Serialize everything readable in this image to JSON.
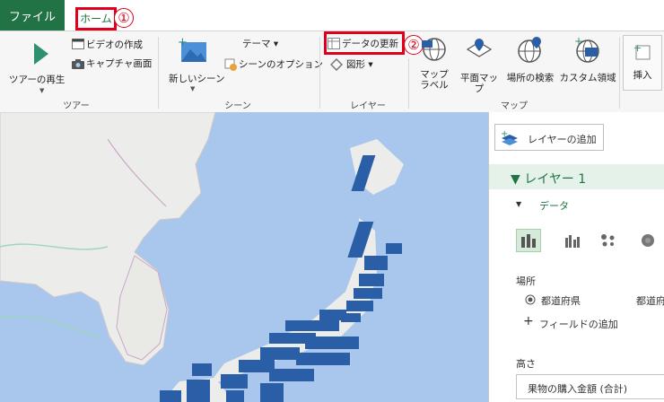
{
  "tabs": {
    "file": "ファイル",
    "home": "ホーム"
  },
  "callouts": {
    "one": "①",
    "two": "②"
  },
  "ribbon": {
    "tour": {
      "play_label": "ツアーの再生",
      "video_label": "ビデオの作成",
      "capture_label": "キャプチャ画面",
      "group_label": "ツアー"
    },
    "scene": {
      "new_scene_label": "新しいシーン",
      "theme_label": "テーマ ▾",
      "scene_options_label": "シーンのオプション",
      "group_label": "シーン"
    },
    "layer": {
      "refresh_label": "データの更新",
      "shapes_label": "図形 ▾",
      "group_label": "レイヤー"
    },
    "map": {
      "map_labels_label_1": "マップ",
      "map_labels_label_2": "ラベル",
      "flat_map_label": "平面マップ",
      "find_location_label": "場所の検索",
      "custom_region_label": "カスタム領域",
      "group_label": "マップ"
    },
    "insert": {
      "label": "挿入"
    }
  },
  "pane": {
    "add_layer_label": "レイヤーの追加",
    "layer_title": "▼  レイヤー 1",
    "data_section": "データ",
    "location_label": "場所",
    "location_field": "都道府県",
    "location_type": "都道府",
    "add_field_label": "フィールドの追加",
    "height_label": "高さ",
    "height_field": "果物の購入金額 (合計)"
  },
  "colors": {
    "excel_green": "#217346",
    "callout_red": "#e0001b",
    "bar_blue": "#2a5fa8",
    "ocean": "#a9c7ec",
    "land": "#ececea"
  }
}
